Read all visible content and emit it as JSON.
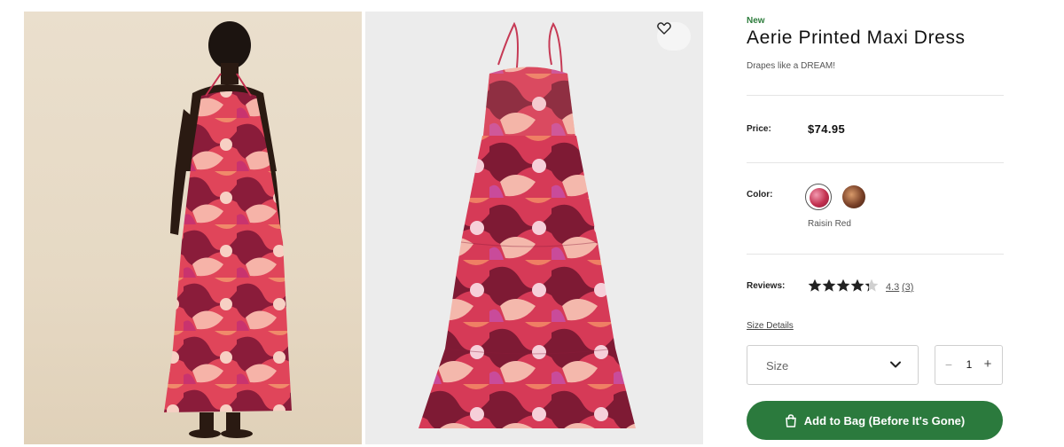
{
  "product": {
    "badge": "New",
    "title": "Aerie Printed Maxi Dress",
    "tagline": "Drapes like a DREAM!"
  },
  "price": {
    "label": "Price:",
    "value": "$74.95"
  },
  "color": {
    "label": "Color:",
    "selected_name": "Raisin Red",
    "swatches": [
      {
        "name": "Raisin Red",
        "hex": "#c2304f",
        "selected": true
      },
      {
        "name": "Brown Print",
        "hex": "#6b3a24",
        "selected": false
      }
    ]
  },
  "reviews": {
    "label": "Reviews:",
    "rating": "4.3",
    "count": "(3)",
    "stars": 4.3,
    "max_stars": 5
  },
  "size_details_label": "Size Details",
  "size_select": {
    "label": "Size"
  },
  "quantity": {
    "minus": "−",
    "value": "1",
    "plus": "+"
  },
  "add_to_bag": {
    "label": "Add to Bag (Before It's Gone)"
  },
  "colors": {
    "accent_green": "#2b7a3d",
    "new_badge": "#2e7d3d"
  }
}
